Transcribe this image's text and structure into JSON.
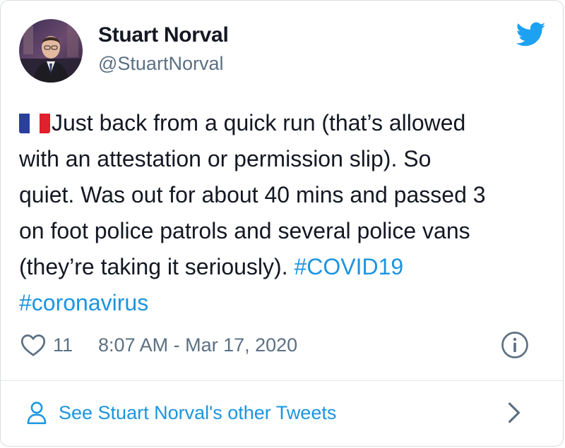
{
  "author": {
    "name": "Stuart Norval",
    "handle": "@StuartNorval",
    "avatar_icon": "profile-photo"
  },
  "brand": {
    "icon": "twitter-bird-icon",
    "color": "#1da1f2"
  },
  "tweet": {
    "flag_icon": "flag-france-icon",
    "lines": [
      "Just back from a quick run (that’s allowed",
      "with an attestation or permission slip). So",
      "quiet. Was out for about 40 mins and passed 3",
      "on foot police patrols and several police vans",
      "(they’re taking it seriously). "
    ],
    "hashtags": [
      "#COVID19",
      "#coronavirus"
    ],
    "hashtag_color": "#1b95e0",
    "text_color": "#141823"
  },
  "meta": {
    "like_icon": "heart-icon",
    "likes": "11",
    "timestamp": "8:07 AM - Mar 17, 2020",
    "info_icon": "info-icon",
    "muted_color": "#5b7083"
  },
  "footer": {
    "person_icon": "person-icon",
    "link_label": "See Stuart Norval's other Tweets",
    "chevron_icon": "chevron-right-icon"
  }
}
